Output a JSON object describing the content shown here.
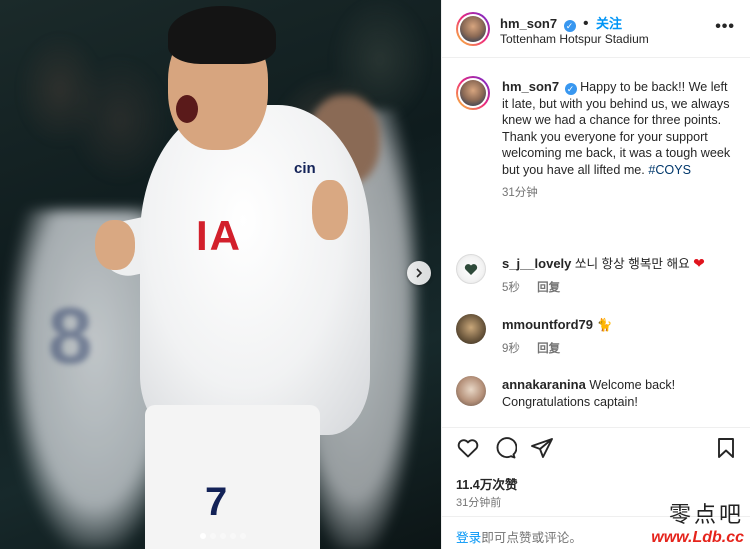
{
  "post": {
    "username": "hm_son7",
    "follow_label": "关注",
    "location": "Tottenham Hotspur Stadium",
    "more_label": "•••",
    "photo": {
      "shirt_sponsor": "IA",
      "sleeve_logo": "cin",
      "back_number": "7",
      "blurred_number": "8",
      "carousel_count": 5,
      "carousel_active": 0
    }
  },
  "caption": {
    "username": "hm_son7",
    "text": "Happy to be back!! We left it late, but with you behind us, we always knew we had a chance for three points. Thank you everyone for your support welcoming me back, it was a tough week but you have all lifted me.",
    "hashtag": "#COYS",
    "time": "31分钟"
  },
  "comments": [
    {
      "username": "s_j__lovely",
      "text": "쏘니 항상 행복만 해요",
      "emoji": "❤",
      "time": "5秒",
      "reply_label": "回复"
    },
    {
      "username": "mmountford79",
      "text": "🐈",
      "time": "9秒",
      "reply_label": "回复"
    },
    {
      "username": "annakaranina",
      "text": "Welcome back! Congratulations captain!"
    }
  ],
  "actions": {
    "likes": "11.4万次赞",
    "time_ago": "31分钟前",
    "login_link": "登录",
    "login_rest": "即可点赞或评论。"
  },
  "watermark": {
    "cn": "零点吧",
    "url": "www.Ldb.cc"
  },
  "colors": {
    "link_blue": "#0095f6",
    "hashtag_blue": "#00376b",
    "muted": "#737373",
    "heart_red": "#ed4956",
    "watermark_red": "#e5241c"
  }
}
